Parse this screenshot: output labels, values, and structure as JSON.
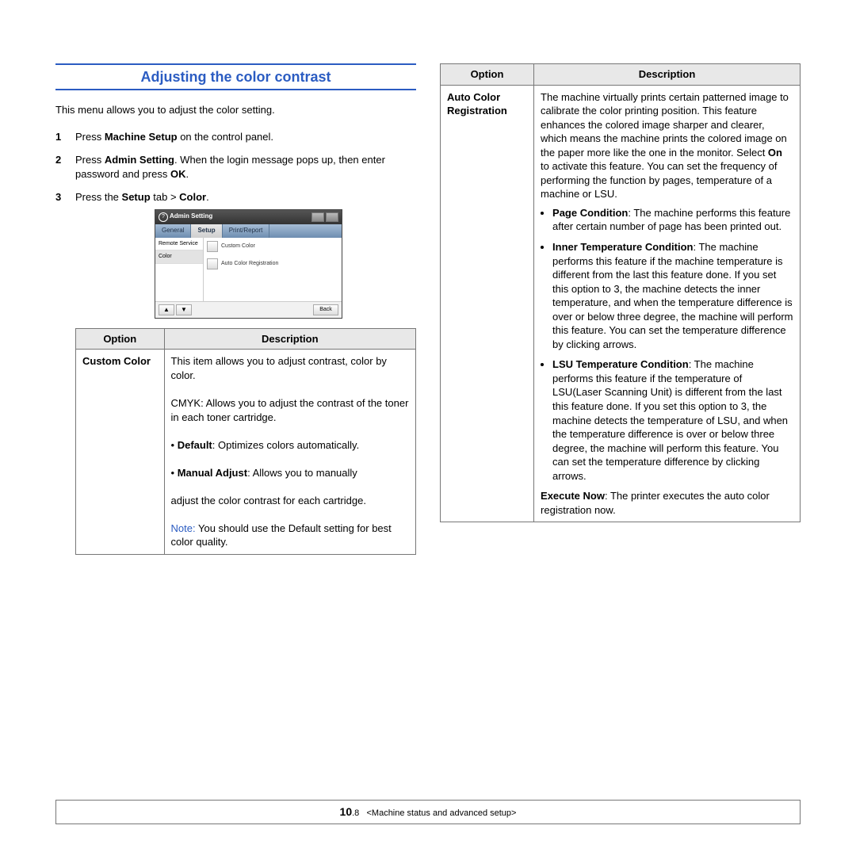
{
  "section_title": "Adjusting the color contrast",
  "intro": "This menu allows you to adjust the color setting.",
  "steps": [
    {
      "n": "1",
      "pre": "Press ",
      "b1": "Machine Setup",
      "post": " on the control panel."
    },
    {
      "n": "2",
      "pre": "Press ",
      "b1": "Admin Setting",
      "mid": ". When the login message pops up, then enter password and press ",
      "b2": "OK",
      "post": "."
    },
    {
      "n": "3",
      "pre": "Press the ",
      "b1": "Setup",
      "mid": " tab > ",
      "b2": "Color",
      "post": "."
    }
  ],
  "ss": {
    "title": "Admin Setting",
    "tabs": [
      "General",
      "Setup",
      "Print/Report"
    ],
    "side": [
      "Remote Service",
      "Color"
    ],
    "items": [
      "Custom Color",
      "Auto Color Registration"
    ],
    "back": "Back"
  },
  "t1": {
    "h1": "Option",
    "h2": "Description",
    "opt": "Custom Color",
    "p1": "This item allows you to adjust contrast, color by color.",
    "p2": "CMYK: Allows you to adjust the contrast of the toner in each toner cartridge.",
    "b1": "Default",
    "b1t": ": Optimizes colors automatically.",
    "b2": "Manual Adjust",
    "b2t": ": Allows you to manually",
    "p3": "adjust the color contrast for each cartridge.",
    "noteL": "Note: ",
    "note": "You should use the Default setting for best color quality."
  },
  "t2": {
    "h1": "Option",
    "h2": "Description",
    "opt": "Auto Color Registration",
    "p1a": "The machine virtually prints certain patterned image to calibrate the color printing position. This feature enhances the colored image sharper and clearer, which means the machine prints the colored image on the paper more like the one in the monitor. Select ",
    "p1b": "On",
    "p1c": " to activate this feature. You can set the frequency of performing the function by pages, temperature of a machine or LSU.",
    "li1b": "Page Condition",
    "li1": ": The machine performs this feature after certain number of page has been printed out.",
    "li2b": "Inner Temperature Condition",
    "li2": ": The machine performs this feature if the machine temperature is different from the last this feature done. If you set this option to 3, the machine detects the inner temperature, and when the temperature difference is over or below three degree, the machine will perform this feature. You can set the temperature difference by clicking arrows.",
    "li3b": "LSU Temperature Condition",
    "li3": ": The machine performs this feature if the temperature of LSU(Laser Scanning Unit) is different from the last this feature done. If you set this option to 3, the machine detects the temperature of LSU, and when the temperature difference is over or below three degree, the machine will perform this feature. You can set the temperature difference by clicking arrows.",
    "p2b": "Execute Now",
    "p2": ": The printer executes the auto color registration now."
  },
  "footer": {
    "chapter": "10",
    "page": ".8",
    "text": "<Machine status and advanced setup>"
  }
}
